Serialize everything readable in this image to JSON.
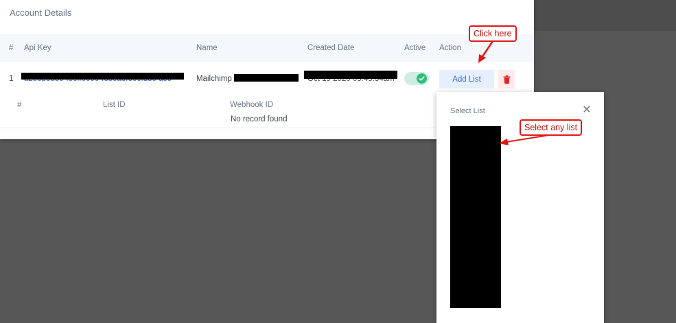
{
  "card": {
    "title": "Account Details",
    "columns": {
      "num": "#",
      "api_key": "Api Key",
      "name": "Name",
      "created": "Created Date",
      "active": "Active",
      "action": "Action"
    },
    "row": {
      "num": "1",
      "api_key_visible": "a2e6b8886-f86ff0000-f6bea6f666fd8c-d59",
      "name_visible": "Mailchimp",
      "created_visible": "Oct 19 2020 05:45:34am",
      "active": true,
      "add_list_label": "Add List"
    },
    "sub_columns": {
      "num": "#",
      "list_id": "List ID",
      "webhook_id": "Webhook ID"
    },
    "empty_text": "No record found"
  },
  "modal": {
    "title": "Select List",
    "close_glyph": "✕"
  },
  "annotations": {
    "click_here": "Click here",
    "select_any_list": "Select any list"
  },
  "colors": {
    "accent": "#3a6bd1",
    "success": "#2ebd7c",
    "danger": "#e02424",
    "annotation": "#e01818"
  }
}
